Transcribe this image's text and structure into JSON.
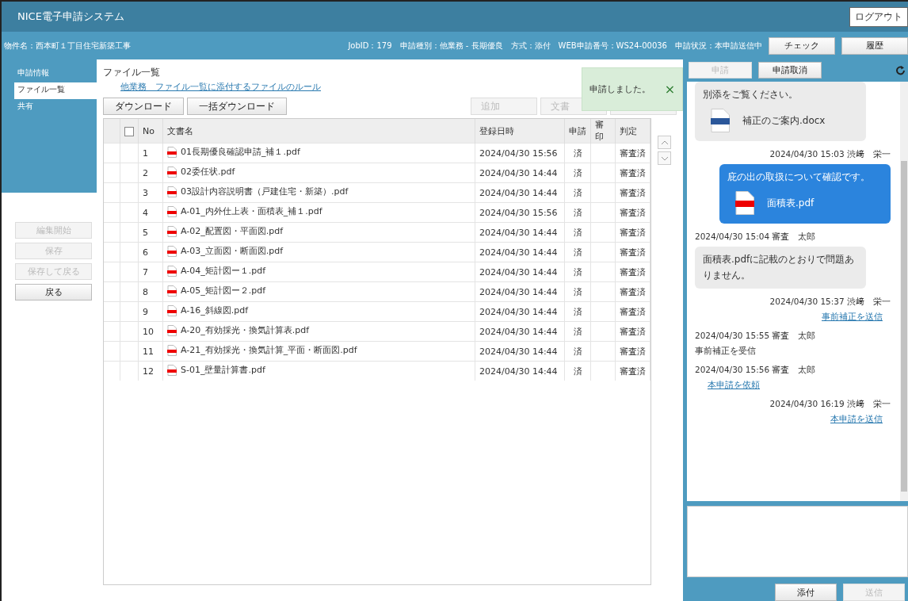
{
  "header": {
    "title": "NICE電子申請システム",
    "logout": "ログアウト"
  },
  "info_bar": {
    "property": "物件名：西本町１丁目住宅新築工事",
    "details": "JobID：179　申請種別：他業務 - 長期優良　方式：添付　WEB申請番号：WS24-00036　申請状況：本申請送信中",
    "buttons": [
      {
        "label": "チェック",
        "disabled": false
      },
      {
        "label": "履歴",
        "disabled": false
      }
    ]
  },
  "sidebar": {
    "items": [
      {
        "label": "申請情報",
        "selected": false
      },
      {
        "label": "ファイル一覧",
        "selected": true
      },
      {
        "label": "共有",
        "selected": false
      }
    ],
    "buttons": [
      {
        "label": "編集開始",
        "disabled": true
      },
      {
        "label": "保存",
        "disabled": true
      },
      {
        "label": "保存して戻る",
        "disabled": true
      },
      {
        "label": "戻る",
        "disabled": false
      }
    ]
  },
  "main": {
    "title": "ファイル一覧",
    "rule_link": "他業務　ファイル一覧に添付するファイルのルール",
    "left_buttons": [
      {
        "label": "ダウンロード",
        "disabled": false
      },
      {
        "label": "一括ダウンロード",
        "disabled": false
      }
    ],
    "right_buttons": [
      {
        "label": "追加",
        "disabled": true
      },
      {
        "label": "文書",
        "disabled": true
      },
      {
        "disabled": true
      }
    ],
    "toast": {
      "message": "申請しました。",
      "close": "×"
    },
    "table": {
      "select_all_checked": false,
      "columns": [
        "No",
        "文書名",
        "登録日時",
        "申請",
        "審印",
        "判定"
      ],
      "rows": [
        {
          "no": "1",
          "name": "01長期優良確認申請_補１.pdf",
          "date": "2024/04/30 15:56",
          "applied": "済",
          "stamp": "",
          "judgement": "審査済"
        },
        {
          "no": "2",
          "name": "02委任状.pdf",
          "date": "2024/04/30 14:44",
          "applied": "済",
          "stamp": "",
          "judgement": "審査済"
        },
        {
          "no": "3",
          "name": "03設計内容説明書（戸建住宅・新築）.pdf",
          "date": "2024/04/30 14:44",
          "applied": "済",
          "stamp": "",
          "judgement": "審査済"
        },
        {
          "no": "4",
          "name": "A-01_内外仕上表・面積表_補１.pdf",
          "date": "2024/04/30 15:56",
          "applied": "済",
          "stamp": "",
          "judgement": "審査済"
        },
        {
          "no": "5",
          "name": "A-02_配置図・平面図.pdf",
          "date": "2024/04/30 14:44",
          "applied": "済",
          "stamp": "",
          "judgement": "審査済"
        },
        {
          "no": "6",
          "name": "A-03_立面図・断面図.pdf",
          "date": "2024/04/30 14:44",
          "applied": "済",
          "stamp": "",
          "judgement": "審査済"
        },
        {
          "no": "7",
          "name": "A-04_矩計図ー１.pdf",
          "date": "2024/04/30 14:44",
          "applied": "済",
          "stamp": "",
          "judgement": "審査済"
        },
        {
          "no": "8",
          "name": "A-05_矩計図ー２.pdf",
          "date": "2024/04/30 14:44",
          "applied": "済",
          "stamp": "",
          "judgement": "審査済"
        },
        {
          "no": "9",
          "name": "A-16_斜線図.pdf",
          "date": "2024/04/30 14:44",
          "applied": "済",
          "stamp": "",
          "judgement": "審査済"
        },
        {
          "no": "10",
          "name": "A-20_有効採光・換気計算表.pdf",
          "date": "2024/04/30 14:44",
          "applied": "済",
          "stamp": "",
          "judgement": "審査済"
        },
        {
          "no": "11",
          "name": "A-21_有効採光・換気計算_平面・断面図.pdf",
          "date": "2024/04/30 14:44",
          "applied": "済",
          "stamp": "",
          "judgement": "審査済"
        },
        {
          "no": "12",
          "name": "S-01_壁量計算書.pdf",
          "date": "2024/04/30 14:44",
          "applied": "済",
          "stamp": "",
          "judgement": "審査済"
        }
      ]
    }
  },
  "chat": {
    "buttons": [
      {
        "label": "申請",
        "disabled": true
      },
      {
        "label": "申請取消",
        "disabled": false
      }
    ],
    "messages": [
      {
        "sent": false,
        "kind": "bubble",
        "text": "別添をご覧ください。",
        "attachment": {
          "kind": "docx",
          "name": "補正のご案内.docx"
        }
      },
      {
        "sent": true,
        "kind": "bubble",
        "meta": "2024/04/30 15:03 渋﨑　栄一",
        "text": "庇の出の取扱について確認です。",
        "attachment": {
          "kind": "pdf",
          "name": "面積表.pdf"
        }
      },
      {
        "sent": false,
        "kind": "bubble",
        "meta": "2024/04/30 15:04 審査　太郎",
        "text": "面積表.pdfに記載のとおりで問題ありません。"
      },
      {
        "sent": true,
        "kind": "link",
        "meta": "2024/04/30 15:37 渋﨑　栄一",
        "text": "事前補正を送信"
      },
      {
        "sent": false,
        "kind": "note",
        "meta": "2024/04/30 15:55 審査　太郎",
        "text": "事前補正を受信"
      },
      {
        "sent": false,
        "kind": "link",
        "meta": "2024/04/30 15:56 審査　太郎",
        "text": "本申請を依頼"
      },
      {
        "sent": true,
        "kind": "link",
        "meta": "2024/04/30 16:19 渋﨑　栄一",
        "text": "本申請を送信"
      }
    ],
    "footer_buttons": [
      {
        "label": "添付",
        "disabled": false
      },
      {
        "label": "送信",
        "disabled": true
      }
    ]
  }
}
